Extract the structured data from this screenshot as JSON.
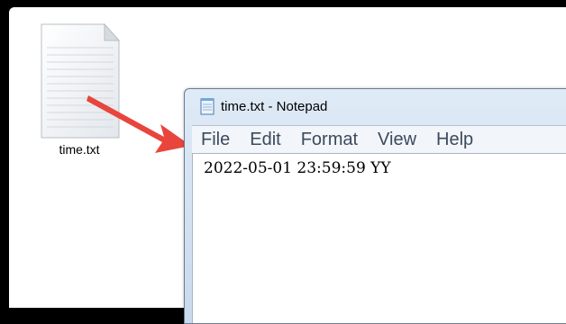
{
  "desktop": {
    "file_name": "time.txt",
    "file_icon": "text-document-icon"
  },
  "annotation": {
    "arrow_color": "#e8453c",
    "arrow_icon": "red-arrow"
  },
  "notepad": {
    "title": "time.txt - Notepad",
    "app_icon": "notepad-icon",
    "menu": [
      {
        "label": "File"
      },
      {
        "label": "Edit"
      },
      {
        "label": "Format"
      },
      {
        "label": "View"
      },
      {
        "label": "Help"
      }
    ],
    "content": "2022-05-01 23:59:59 YY"
  }
}
